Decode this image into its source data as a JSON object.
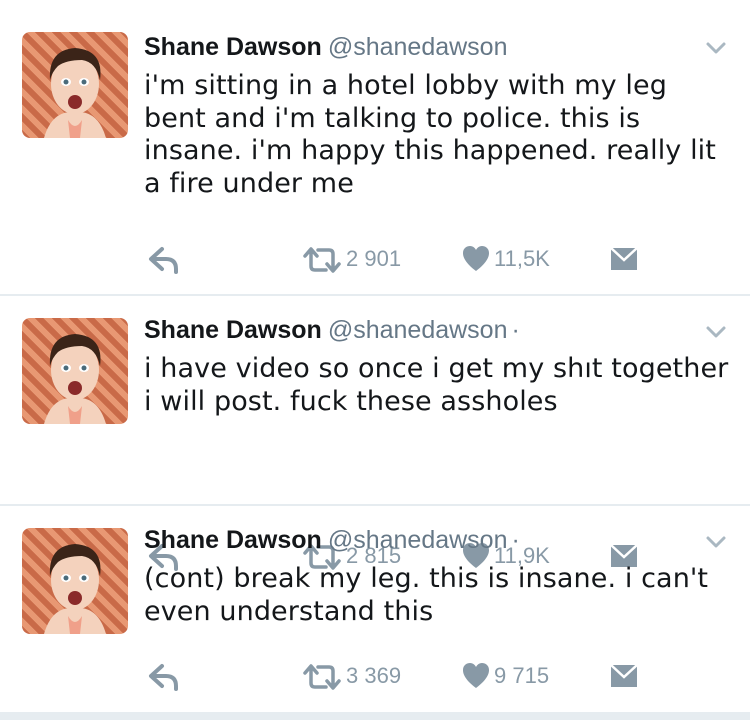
{
  "colors": {
    "text": "#14171a",
    "secondary": "#657786",
    "action": "#8899a6",
    "divider": "#e6ecf0"
  },
  "icons": {
    "reply": "reply-icon",
    "retweet": "retweet-icon",
    "like": "heart-icon",
    "message": "envelope-icon",
    "menu": "chevron-down-icon"
  },
  "tweets": [
    {
      "name": "Shane Dawson",
      "handle": "@shanedawson",
      "dot": "",
      "text": "i'm sitting in a hotel lobby with my leg bent and i'm talking to police. this is insane. i'm happy this happened. really lit a fire under me",
      "retweets": "2 901",
      "likes": "11,5K"
    },
    {
      "name": "Shane Dawson",
      "handle": "@shanedawson",
      "dot": "·",
      "text": "i have video so once i get my shıt together i will post. fuck these assholes",
      "retweets": "2 815",
      "likes": "11,9K"
    },
    {
      "name": "Shane Dawson",
      "handle": "@shanedawson",
      "dot": "·",
      "text": "(cont) break my leg. this is insane. i can't even understand this",
      "retweets": "3 369",
      "likes": "9 715"
    }
  ]
}
